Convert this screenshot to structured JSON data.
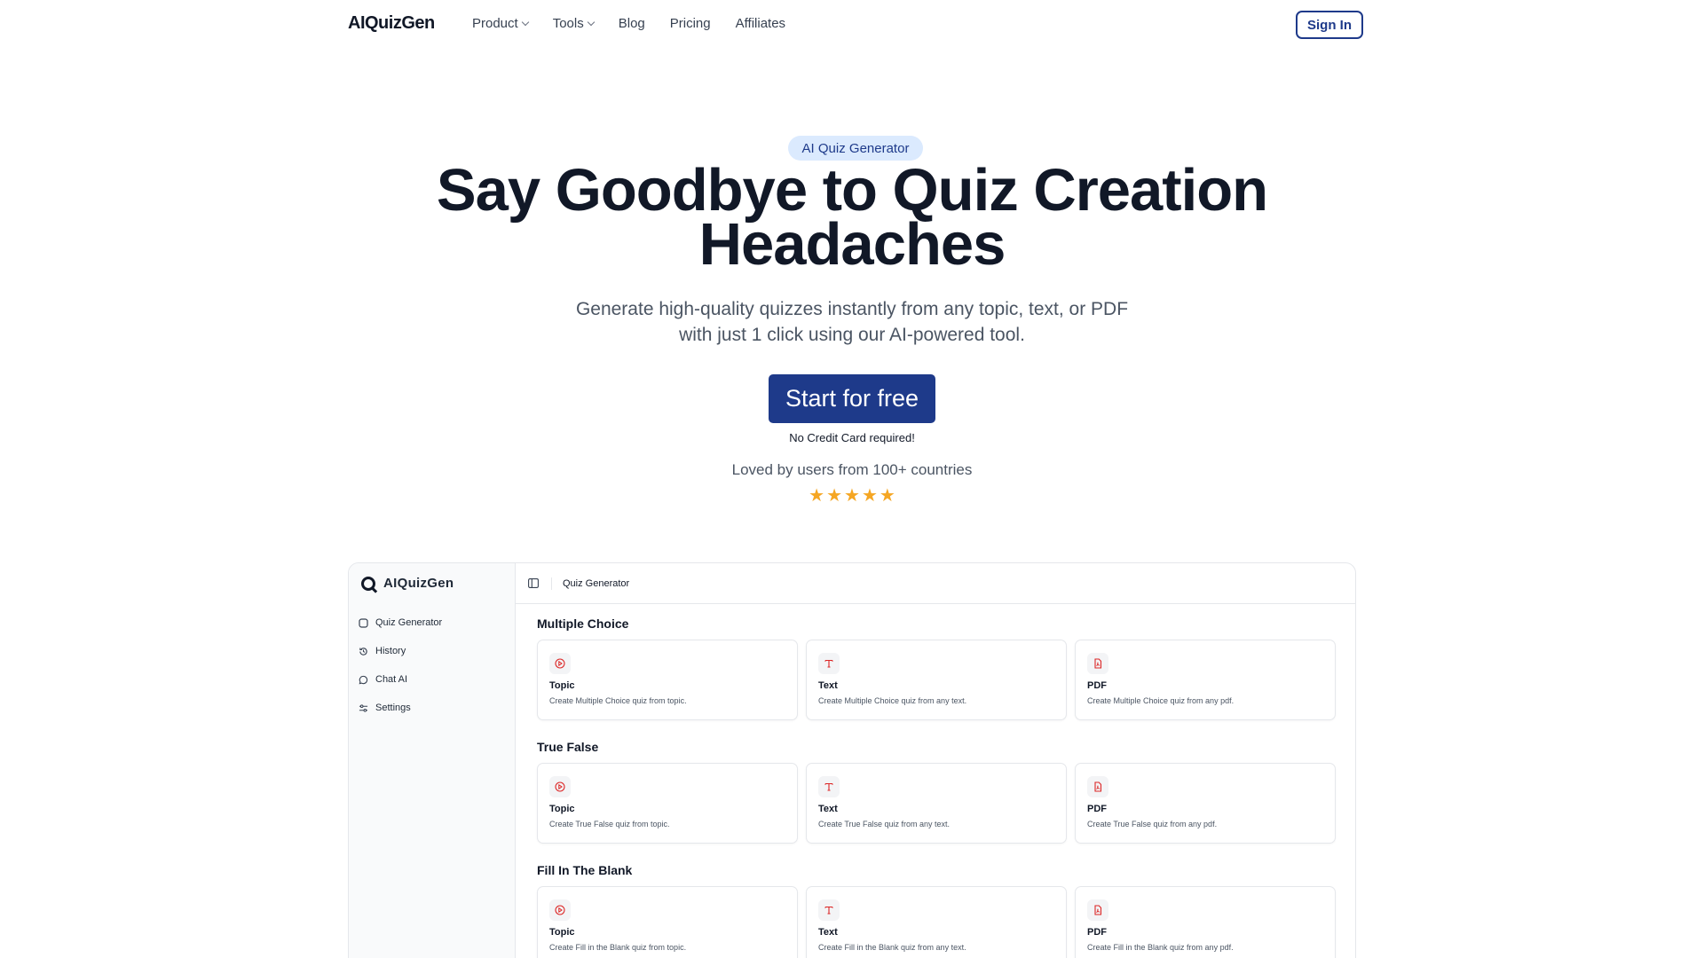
{
  "nav": {
    "brand": "AIQuizGen",
    "links": [
      {
        "label": "Product",
        "has_dropdown": true
      },
      {
        "label": "Tools",
        "has_dropdown": true
      },
      {
        "label": "Blog",
        "has_dropdown": false
      },
      {
        "label": "Pricing",
        "has_dropdown": false
      },
      {
        "label": "Affiliates",
        "has_dropdown": false
      }
    ],
    "signin_label": "Sign In"
  },
  "hero": {
    "badge": "AI Quiz Generator",
    "headline_line1": "Say Goodbye to Quiz Creation",
    "headline_line2": "Headaches",
    "sub_line1": "Generate high-quality quizzes instantly from any topic, text, or PDF",
    "sub_line2": "with just 1 click using our AI-powered tool.",
    "cta_label": "Start for free",
    "no_card": "No Credit Card required!",
    "loved": "Loved by users from 100+ countries",
    "rating_stars": 5
  },
  "app_preview": {
    "logo_text": "AIQuizGen",
    "sidebar": [
      {
        "label": "Quiz Generator",
        "icon": "square-icon"
      },
      {
        "label": "History",
        "icon": "history-icon"
      },
      {
        "label": "Chat AI",
        "icon": "chat-bubble-icon"
      },
      {
        "label": "Settings",
        "icon": "sliders-icon"
      }
    ],
    "top_title": "Quiz Generator",
    "sections": [
      {
        "title": "Multiple Choice",
        "cards": [
          {
            "title": "Topic",
            "desc": "Create Multiple Choice quiz from topic.",
            "icon": "play-icon"
          },
          {
            "title": "Text",
            "desc": "Create Multiple Choice quiz from any text.",
            "icon": "text-icon"
          },
          {
            "title": "PDF",
            "desc": "Create Multiple Choice quiz from any pdf.",
            "icon": "pdf-icon"
          }
        ]
      },
      {
        "title": "True False",
        "cards": [
          {
            "title": "Topic",
            "desc": "Create True False quiz from topic.",
            "icon": "play-icon"
          },
          {
            "title": "Text",
            "desc": "Create True False quiz from any text.",
            "icon": "text-icon"
          },
          {
            "title": "PDF",
            "desc": "Create True False quiz from any pdf.",
            "icon": "pdf-icon"
          }
        ]
      },
      {
        "title": "Fill In The Blank",
        "cards": [
          {
            "title": "Topic",
            "desc": "Create Fill in the Blank quiz from topic.",
            "icon": "play-icon"
          },
          {
            "title": "Text",
            "desc": "Create Fill in the Blank quiz from any text.",
            "icon": "text-icon"
          },
          {
            "title": "PDF",
            "desc": "Create Fill in the Blank quiz from any pdf.",
            "icon": "pdf-icon"
          }
        ]
      }
    ]
  },
  "colors": {
    "brand_navy": "#1e3a8a",
    "badge_bg": "#dbeafe",
    "star": "#f5a623",
    "icon_red": "#dc2626"
  }
}
